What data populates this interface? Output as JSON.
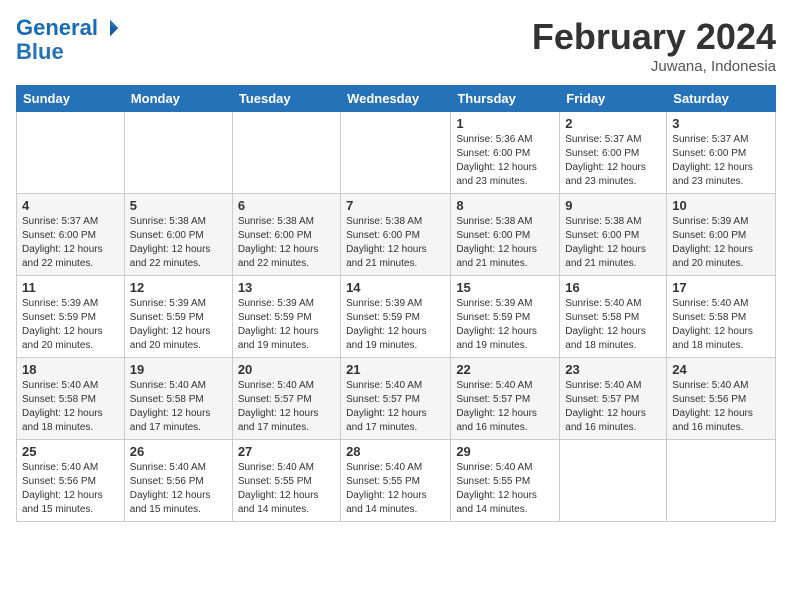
{
  "header": {
    "logo_line1": "General",
    "logo_line2": "Blue",
    "month": "February 2024",
    "location": "Juwana, Indonesia"
  },
  "days_of_week": [
    "Sunday",
    "Monday",
    "Tuesday",
    "Wednesday",
    "Thursday",
    "Friday",
    "Saturday"
  ],
  "weeks": [
    [
      {
        "day": "",
        "info": ""
      },
      {
        "day": "",
        "info": ""
      },
      {
        "day": "",
        "info": ""
      },
      {
        "day": "",
        "info": ""
      },
      {
        "day": "1",
        "info": "Sunrise: 5:36 AM\nSunset: 6:00 PM\nDaylight: 12 hours\nand 23 minutes."
      },
      {
        "day": "2",
        "info": "Sunrise: 5:37 AM\nSunset: 6:00 PM\nDaylight: 12 hours\nand 23 minutes."
      },
      {
        "day": "3",
        "info": "Sunrise: 5:37 AM\nSunset: 6:00 PM\nDaylight: 12 hours\nand 23 minutes."
      }
    ],
    [
      {
        "day": "4",
        "info": "Sunrise: 5:37 AM\nSunset: 6:00 PM\nDaylight: 12 hours\nand 22 minutes."
      },
      {
        "day": "5",
        "info": "Sunrise: 5:38 AM\nSunset: 6:00 PM\nDaylight: 12 hours\nand 22 minutes."
      },
      {
        "day": "6",
        "info": "Sunrise: 5:38 AM\nSunset: 6:00 PM\nDaylight: 12 hours\nand 22 minutes."
      },
      {
        "day": "7",
        "info": "Sunrise: 5:38 AM\nSunset: 6:00 PM\nDaylight: 12 hours\nand 21 minutes."
      },
      {
        "day": "8",
        "info": "Sunrise: 5:38 AM\nSunset: 6:00 PM\nDaylight: 12 hours\nand 21 minutes."
      },
      {
        "day": "9",
        "info": "Sunrise: 5:38 AM\nSunset: 6:00 PM\nDaylight: 12 hours\nand 21 minutes."
      },
      {
        "day": "10",
        "info": "Sunrise: 5:39 AM\nSunset: 6:00 PM\nDaylight: 12 hours\nand 20 minutes."
      }
    ],
    [
      {
        "day": "11",
        "info": "Sunrise: 5:39 AM\nSunset: 5:59 PM\nDaylight: 12 hours\nand 20 minutes."
      },
      {
        "day": "12",
        "info": "Sunrise: 5:39 AM\nSunset: 5:59 PM\nDaylight: 12 hours\nand 20 minutes."
      },
      {
        "day": "13",
        "info": "Sunrise: 5:39 AM\nSunset: 5:59 PM\nDaylight: 12 hours\nand 19 minutes."
      },
      {
        "day": "14",
        "info": "Sunrise: 5:39 AM\nSunset: 5:59 PM\nDaylight: 12 hours\nand 19 minutes."
      },
      {
        "day": "15",
        "info": "Sunrise: 5:39 AM\nSunset: 5:59 PM\nDaylight: 12 hours\nand 19 minutes."
      },
      {
        "day": "16",
        "info": "Sunrise: 5:40 AM\nSunset: 5:58 PM\nDaylight: 12 hours\nand 18 minutes."
      },
      {
        "day": "17",
        "info": "Sunrise: 5:40 AM\nSunset: 5:58 PM\nDaylight: 12 hours\nand 18 minutes."
      }
    ],
    [
      {
        "day": "18",
        "info": "Sunrise: 5:40 AM\nSunset: 5:58 PM\nDaylight: 12 hours\nand 18 minutes."
      },
      {
        "day": "19",
        "info": "Sunrise: 5:40 AM\nSunset: 5:58 PM\nDaylight: 12 hours\nand 17 minutes."
      },
      {
        "day": "20",
        "info": "Sunrise: 5:40 AM\nSunset: 5:57 PM\nDaylight: 12 hours\nand 17 minutes."
      },
      {
        "day": "21",
        "info": "Sunrise: 5:40 AM\nSunset: 5:57 PM\nDaylight: 12 hours\nand 17 minutes."
      },
      {
        "day": "22",
        "info": "Sunrise: 5:40 AM\nSunset: 5:57 PM\nDaylight: 12 hours\nand 16 minutes."
      },
      {
        "day": "23",
        "info": "Sunrise: 5:40 AM\nSunset: 5:57 PM\nDaylight: 12 hours\nand 16 minutes."
      },
      {
        "day": "24",
        "info": "Sunrise: 5:40 AM\nSunset: 5:56 PM\nDaylight: 12 hours\nand 16 minutes."
      }
    ],
    [
      {
        "day": "25",
        "info": "Sunrise: 5:40 AM\nSunset: 5:56 PM\nDaylight: 12 hours\nand 15 minutes."
      },
      {
        "day": "26",
        "info": "Sunrise: 5:40 AM\nSunset: 5:56 PM\nDaylight: 12 hours\nand 15 minutes."
      },
      {
        "day": "27",
        "info": "Sunrise: 5:40 AM\nSunset: 5:55 PM\nDaylight: 12 hours\nand 14 minutes."
      },
      {
        "day": "28",
        "info": "Sunrise: 5:40 AM\nSunset: 5:55 PM\nDaylight: 12 hours\nand 14 minutes."
      },
      {
        "day": "29",
        "info": "Sunrise: 5:40 AM\nSunset: 5:55 PM\nDaylight: 12 hours\nand 14 minutes."
      },
      {
        "day": "",
        "info": ""
      },
      {
        "day": "",
        "info": ""
      }
    ]
  ]
}
